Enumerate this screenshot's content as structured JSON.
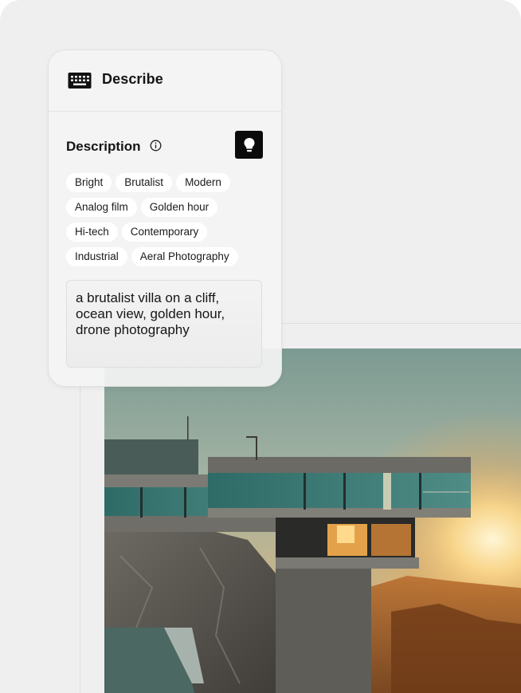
{
  "card": {
    "title": "Describe",
    "header_icon": "keyboard-icon"
  },
  "description": {
    "label": "Description",
    "info_icon": "info-icon",
    "suggest_icon": "lightbulb-icon"
  },
  "tags": [
    [
      "Bright",
      "Brutalist",
      "Modern"
    ],
    [
      "Analog film",
      "Golden hour"
    ],
    [
      "Hi-tech",
      "Contemporary"
    ],
    [
      "Industrial",
      "Aeral Photography"
    ]
  ],
  "prompt": {
    "value": "a brutalist villa on a cliff, ocean view, golden hour, drone photography"
  },
  "colors": {
    "background": "#efefef",
    "card": "#f4f4f4",
    "accent_dark": "#0b0b0b",
    "tag_bg": "#ffffff"
  }
}
